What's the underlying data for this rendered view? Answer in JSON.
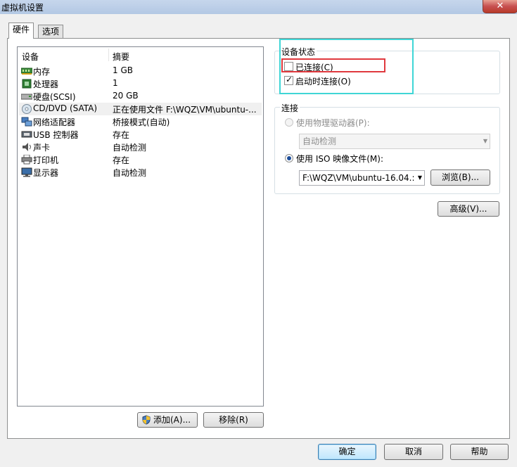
{
  "window": {
    "title": "虚拟机设置",
    "close_glyph": "✕"
  },
  "tabs": [
    {
      "label": "硬件",
      "active": true
    },
    {
      "label": "选项",
      "active": false
    }
  ],
  "device_list": {
    "columns": [
      "设备",
      "摘要"
    ],
    "rows": [
      {
        "name": "内存",
        "summary": "1 GB",
        "icon": "memory-icon"
      },
      {
        "name": "处理器",
        "summary": "1",
        "icon": "processor-icon"
      },
      {
        "name": "硬盘(SCSI)",
        "summary": "20 GB",
        "icon": "harddisk-icon"
      },
      {
        "name": "CD/DVD (SATA)",
        "summary": "正在使用文件 F:\\WQZ\\VM\\ubuntu-...",
        "icon": "cd-dvd-icon",
        "selected": true
      },
      {
        "name": "网络适配器",
        "summary": "桥接模式(自动)",
        "icon": "network-adapter-icon"
      },
      {
        "name": "USB 控制器",
        "summary": "存在",
        "icon": "usb-icon"
      },
      {
        "name": "声卡",
        "summary": "自动检测",
        "icon": "sound-card-icon"
      },
      {
        "name": "打印机",
        "summary": "存在",
        "icon": "printer-icon"
      },
      {
        "name": "显示器",
        "summary": "自动检测",
        "icon": "monitor-icon"
      }
    ]
  },
  "list_buttons": {
    "add": "添加(A)...",
    "remove": "移除(R)"
  },
  "device_status": {
    "title": "设备状态",
    "connected_label": "已连接(C)",
    "connected_checked": false,
    "connect_at_power_on_label": "启动时连接(O)",
    "connect_at_power_on_checked": true
  },
  "connection": {
    "title": "连接",
    "physical_drive_label": "使用物理驱动器(P):",
    "physical_drive_value": "自动检测",
    "iso_label": "使用 ISO 映像文件(M):",
    "iso_selected": true,
    "iso_path": "F:\\WQZ\\VM\\ubuntu-16.04.:",
    "browse_label": "浏览(B)..."
  },
  "advanced_button": "高级(V)...",
  "footer": {
    "ok": "确定",
    "cancel": "取消",
    "help": "帮助"
  },
  "highlight_colors": {
    "cyan": "#3fd6d6",
    "red": "#e0393e"
  }
}
